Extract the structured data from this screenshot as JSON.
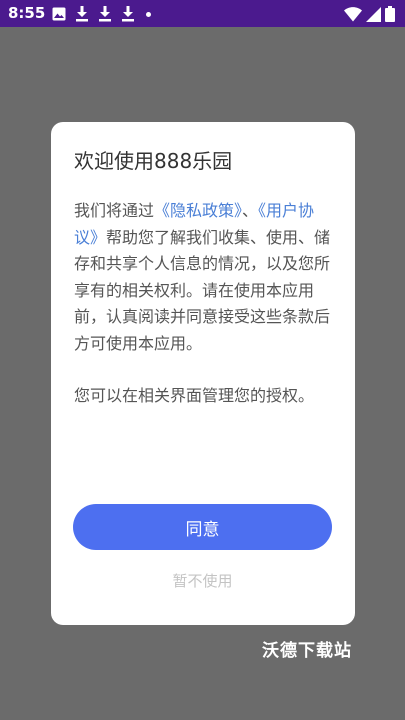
{
  "status_bar": {
    "time": "8:55",
    "left_icons": [
      "image-icon",
      "download-icon",
      "download-icon",
      "download-icon",
      "dot-icon"
    ],
    "right_icons": [
      "wifi-icon",
      "signal-icon",
      "battery-icon"
    ],
    "background": "#4b1a8e"
  },
  "dialog": {
    "title": "欢迎使用888乐园",
    "body": {
      "p1_a": "我们将通过",
      "privacy_link": "《隐私政策》",
      "sep": "、",
      "agreement_link": "《用户协议》",
      "p1_b": "帮助您了解我们收集、使用、储存和共享个人信息的情况，以及您所享有的相关权利。请在使用本应用前，认真阅读并同意接受这些条款后方可使用本应用。",
      "p2": "您可以在相关界面管理您的授权。"
    },
    "agree_label": "同意",
    "decline_label": "暂不使用",
    "accent_color": "#4d6ff0",
    "link_color": "#4a7fd6"
  },
  "watermark": "沃德下载站"
}
